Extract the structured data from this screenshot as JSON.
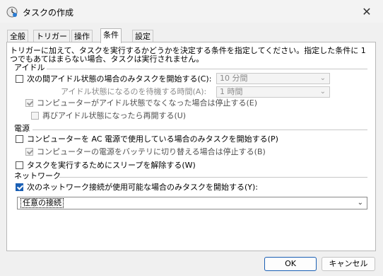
{
  "window": {
    "title": "タスクの作成",
    "icon": "task-scheduler-icon",
    "close_glyph": "✕"
  },
  "tabs": [
    {
      "label": "全般"
    },
    {
      "label": "トリガー"
    },
    {
      "label": "操作"
    },
    {
      "label": "条件"
    },
    {
      "label": "設定"
    }
  ],
  "active_tab": "条件",
  "description": "トリガーに加えて、タスクを実行するかどうかを決定する条件を指定してください。指定した条件に 1 つでもあてはまらない場合、タスクは実行されません。",
  "idle": {
    "group_label": "アイドル",
    "start_only_if_idle": {
      "label": "次の間アイドル状態の場合のみタスクを開始する(C):",
      "checked": false
    },
    "idle_duration": {
      "value": "10 分間"
    },
    "wait_label": "アイドル状態になるのを待機する時間(A):",
    "wait_duration": {
      "value": "1 時間"
    },
    "stop_if_not_idle": {
      "label": "コンピューターがアイドル状態でなくなった場合は停止する(E)",
      "checked": true,
      "enabled": false
    },
    "restart_if_idle": {
      "label": "再びアイドル状態になったら再開する(U)",
      "checked": false,
      "enabled": false
    }
  },
  "power": {
    "group_label": "電源",
    "ac_only": {
      "label": "コンピューターを AC 電源で使用している場合のみタスクを開始する(P)",
      "checked": false
    },
    "stop_on_battery": {
      "label": "コンピューターの電源をバッテリに切り替える場合は停止する(B)",
      "checked": true,
      "enabled": false
    },
    "wake": {
      "label": "タスクを実行するためにスリープを解除する(W)",
      "checked": false
    }
  },
  "network": {
    "group_label": "ネットワーク",
    "only_if_network": {
      "label": "次のネットワーク接続が使用可能な場合のみタスクを開始する(Y):",
      "checked": true
    },
    "connection": {
      "value": "任意の接続"
    }
  },
  "buttons": {
    "ok": "OK",
    "cancel": "キャンセル"
  }
}
